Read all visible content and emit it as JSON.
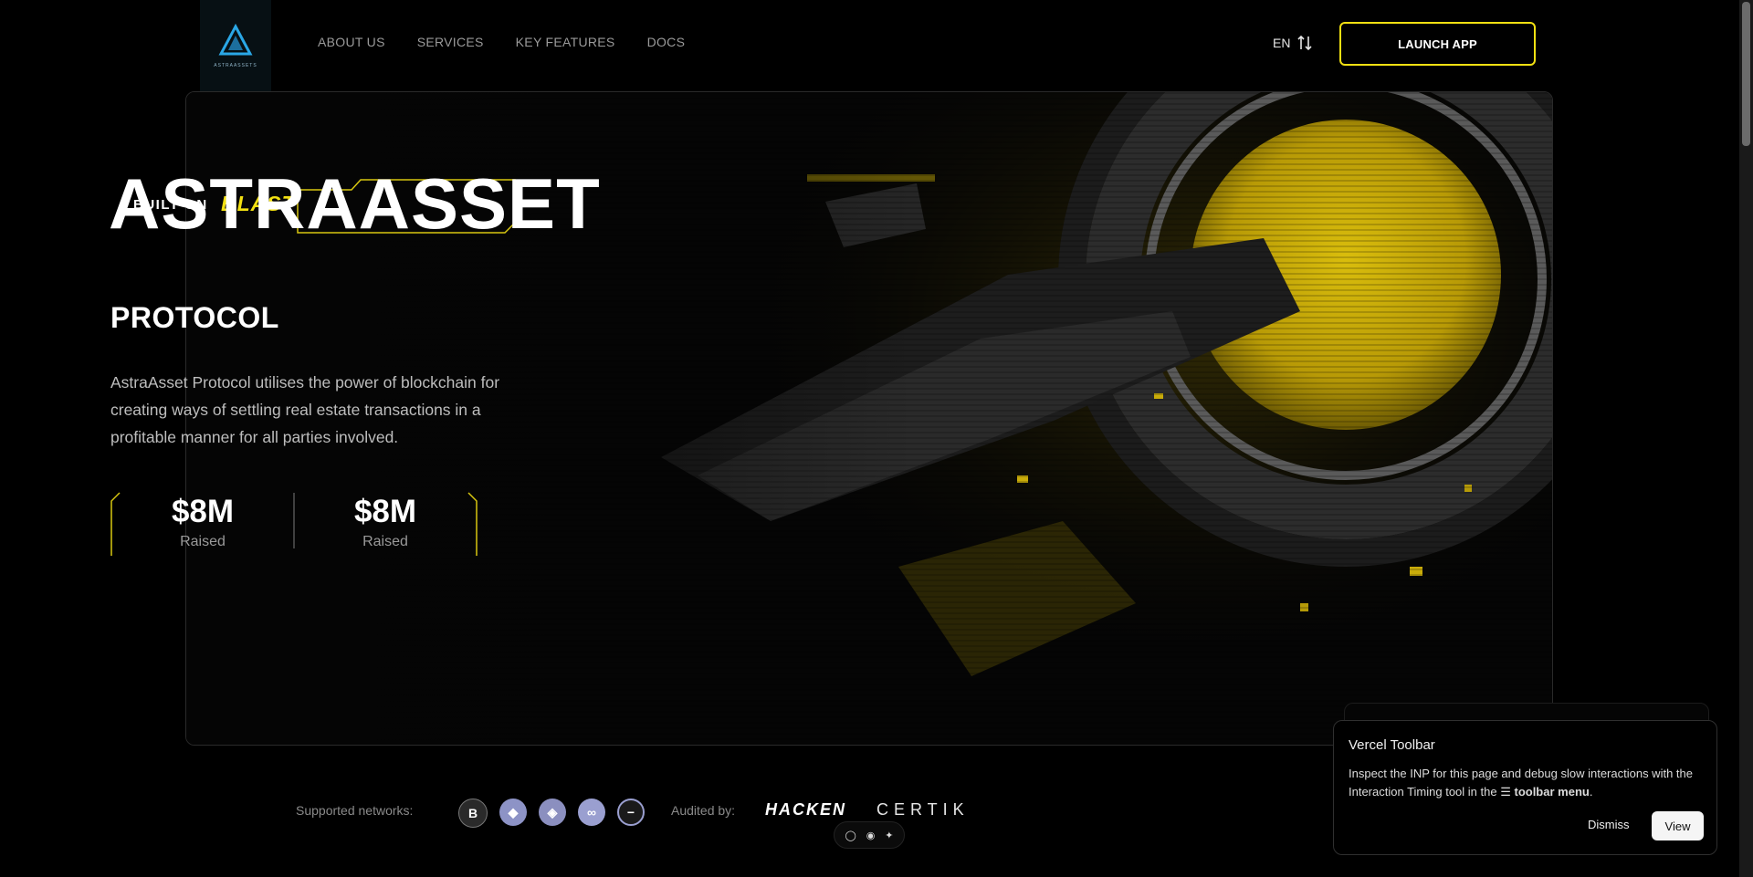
{
  "header": {
    "logo_text": "ASTRAASSETS",
    "nav": [
      {
        "label": "ABOUT US"
      },
      {
        "label": "SERVICES"
      },
      {
        "label": "KEY FEATURES"
      },
      {
        "label": "DOCS"
      }
    ],
    "language": "EN",
    "launch_label": "LAUNCH APP"
  },
  "hero": {
    "badge_prefix": "BUILT ON",
    "badge_brand": "BLAST",
    "title": "ASTRAASSET",
    "subtitle": "PROTOCOL",
    "description": "AstraAsset Protocol utilises the power of blockchain for creating ways of settling real estate transactions in a profitable manner for all parties involved.",
    "stats": [
      {
        "value": "$8M",
        "label": "Raised"
      },
      {
        "value": "$8M",
        "label": "Raised"
      }
    ]
  },
  "footer": {
    "networks_label": "Supported networks:",
    "networks": [
      {
        "icon": "blast-icon",
        "glyph": "B",
        "color": "#2a2a2a"
      },
      {
        "icon": "ethereum-icon",
        "glyph": "◆",
        "color": "#8d93c6"
      },
      {
        "icon": "bnb-icon",
        "glyph": "◈",
        "color": "#8b8fbf"
      },
      {
        "icon": "polygon-icon",
        "glyph": "∞",
        "color": "#9a9fd0"
      },
      {
        "icon": "other-network-icon",
        "glyph": "−",
        "color": "#9a9fd0"
      }
    ],
    "audited_label": "Audited by:",
    "auditors": [
      "HACKEN",
      "CERTIK"
    ]
  },
  "mini_toolbar": {
    "icons": [
      "comment-icon",
      "eye-icon",
      "accessibility-icon"
    ]
  },
  "vercel_toolbar": {
    "title": "Vercel Toolbar",
    "body_start": "Inspect the INP for this page and debug slow interactions with the Interaction Timing tool in the ",
    "body_bold": "toolbar menu",
    "body_end": ".",
    "dismiss_label": "Dismiss",
    "view_label": "View"
  },
  "colors": {
    "accent": "#f2e012",
    "background": "#000000"
  }
}
